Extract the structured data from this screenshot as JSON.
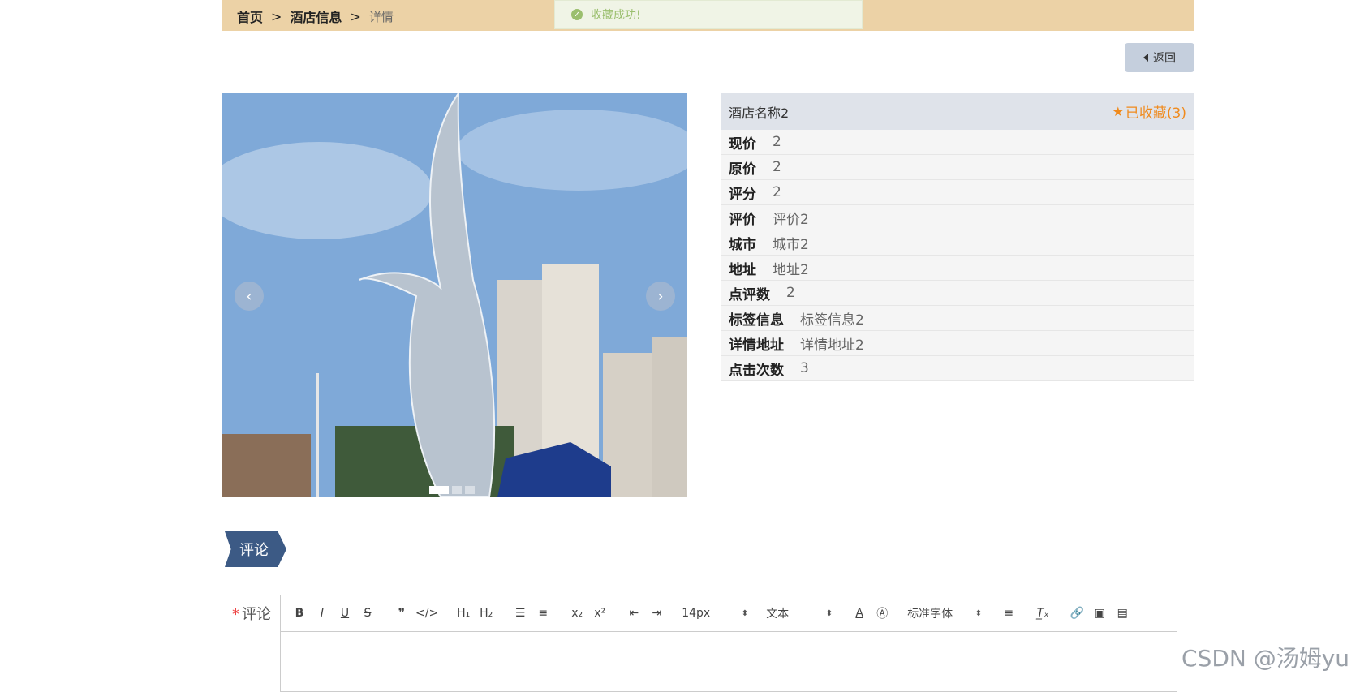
{
  "breadcrumb": {
    "home": "首页",
    "sep1": ">",
    "hotel_info": "酒店信息",
    "sep2": ">",
    "current": "详情"
  },
  "toast": {
    "message": "收藏成功!"
  },
  "back_button": {
    "label": "返回"
  },
  "hotel": {
    "name": "酒店名称2",
    "favorite_label": "已收藏(3)",
    "fields": [
      {
        "key": "现价",
        "value": "2"
      },
      {
        "key": "原价",
        "value": "2"
      },
      {
        "key": "评分",
        "value": "2"
      },
      {
        "key": "评价",
        "value": "评价2"
      },
      {
        "key": "城市",
        "value": "城市2"
      },
      {
        "key": "地址",
        "value": "地址2"
      },
      {
        "key": "点评数",
        "value": "2"
      },
      {
        "key": "标签信息",
        "value": "标签信息2"
      },
      {
        "key": "详情地址",
        "value": "详情地址2"
      },
      {
        "key": "点击次数",
        "value": "3"
      }
    ]
  },
  "carousel": {
    "prev": "‹",
    "next": "›"
  },
  "comments": {
    "section_title": "评论",
    "field_label": "评论",
    "required_mark": "*"
  },
  "editor_toolbar": {
    "font_size": "14px",
    "paragraph": "文本",
    "font_family": "标准字体"
  },
  "watermark": "CSDN @汤姆yu"
}
